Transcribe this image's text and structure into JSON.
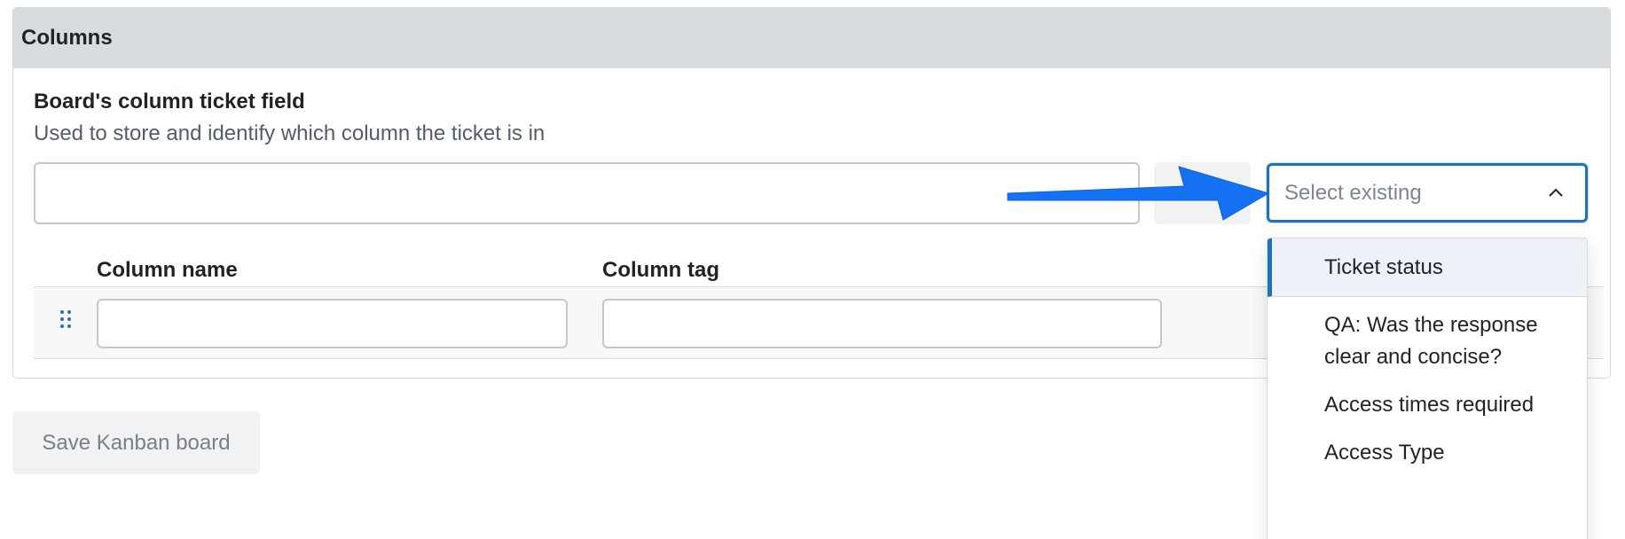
{
  "panel": {
    "title": "Columns",
    "field_label": "Board's column ticket field",
    "field_help": "Used to store and identify which column the ticket is in",
    "field_value": ""
  },
  "table": {
    "headers": [
      "Column name",
      "Column tag"
    ],
    "rows": [
      {
        "name": "",
        "tag": ""
      }
    ]
  },
  "select": {
    "placeholder": "Select existing",
    "expanded": true,
    "options": [
      {
        "label": "Ticket status",
        "highlighted": true
      },
      {
        "label": "QA: Was the response clear and concise?"
      },
      {
        "label": "Access times required"
      },
      {
        "label": "Access Type"
      }
    ]
  },
  "actions": {
    "save_label": "Save Kanban board"
  },
  "icons": {
    "drag_handle": "drag-handle-icon",
    "chevron": "chevron-up-icon",
    "annotation": "blue-arrow-annotation"
  },
  "colors": {
    "accent": "#1f73b7",
    "header_bg": "#d9dcdf",
    "arrow": "#1572f5"
  }
}
